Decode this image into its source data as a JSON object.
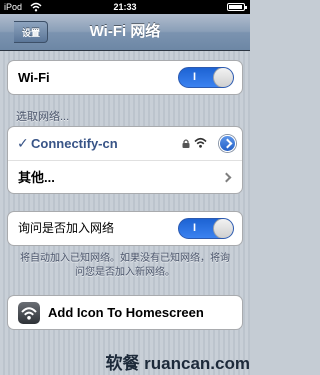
{
  "status_bar": {
    "carrier": "iPod",
    "time": "21:33"
  },
  "nav": {
    "title": "Wi-Fi 网络",
    "back_label": "设置"
  },
  "wifi": {
    "label": "Wi-Fi",
    "toggle_state": "I"
  },
  "networks": {
    "header": "选取网络...",
    "current": {
      "check": "✓",
      "name": "Connectify-cn"
    },
    "other": {
      "label": "其他..."
    }
  },
  "ask": {
    "label": "询问是否加入网络",
    "toggle_state": "I",
    "note": "将自动加入已知网络。如果没有已知网络，将询问您是否加入新网络。"
  },
  "homescreen": {
    "label": "Add Icon To Homescreen"
  },
  "watermark": {
    "text": "软餐 ruancan.com"
  },
  "colors": {
    "accent": "#385487",
    "toggle_on": "#2b6fdc",
    "nav_bar": "#7b93b0"
  }
}
